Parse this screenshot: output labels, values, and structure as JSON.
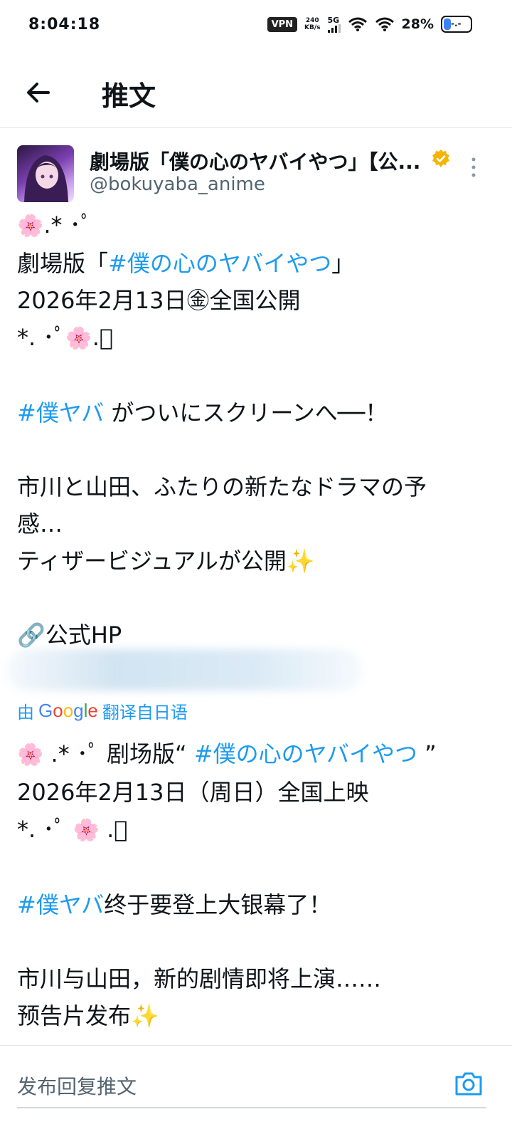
{
  "status_bar": {
    "time": "8:04:18",
    "vpn": "VPN",
    "net_speed_value": "240",
    "net_speed_unit": "KB/s",
    "network": "5G",
    "battery": "28%",
    "battery_level": 0.28
  },
  "header": {
    "title": "推文"
  },
  "tweet": {
    "author_name": "劇場版「僕の心のヤバイやつ」【公...",
    "handle": "@bokuyaba_anime",
    "lines": {
      "l1_flower": "🌸",
      "l1_dots": ".* ･ﾟ",
      "l2_prefix": "劇場版「",
      "l2_tag": "#僕の心のヤバイやつ",
      "l2_suffix": "」",
      "l3": "2026年2月13日㊎全国公開",
      "l4_dots_a": "*. ･ﾟ",
      "l4_flower": "🌸",
      "l4_dots_b": ".ﾟ",
      "l6_tag": "#僕ヤバ",
      "l6_rest": " がついにスクリーンへ──！",
      "l8": "市川と山田、ふたりの新たなドラマの予",
      "l9": "感…",
      "l10_text": "ティザービジュアルが公開",
      "l10_spark": "✨",
      "l12_icon": "🔗",
      "l12_text": "公式HP"
    }
  },
  "translate": {
    "prefix": "由",
    "google": "Google",
    "suffix": "翻译自日语"
  },
  "translation": {
    "t1_flower": "🌸",
    "t1_dots": " .* ･ﾟ 剧场版“ ",
    "t1_tag": "#僕の心のヤバイやつ",
    "t1_end": " ”",
    "t2": "2026年2月13日（周日）全国上映",
    "t3_dots": "*. ･ﾟ ",
    "t3_flower": "🌸",
    "t3_end": " .ﾟ",
    "t5_tag": "#僕ヤバ",
    "t5_rest": "终于要登上大银幕了！",
    "t7": "市川与山田，新的剧情即将上演……",
    "t8_text": "预告片发布",
    "t8_spark": "✨"
  },
  "reply": {
    "placeholder": "发布回复推文"
  },
  "colors": {
    "accent": "#1d9bf0",
    "verified": "#f4b400",
    "muted": "#536471"
  }
}
